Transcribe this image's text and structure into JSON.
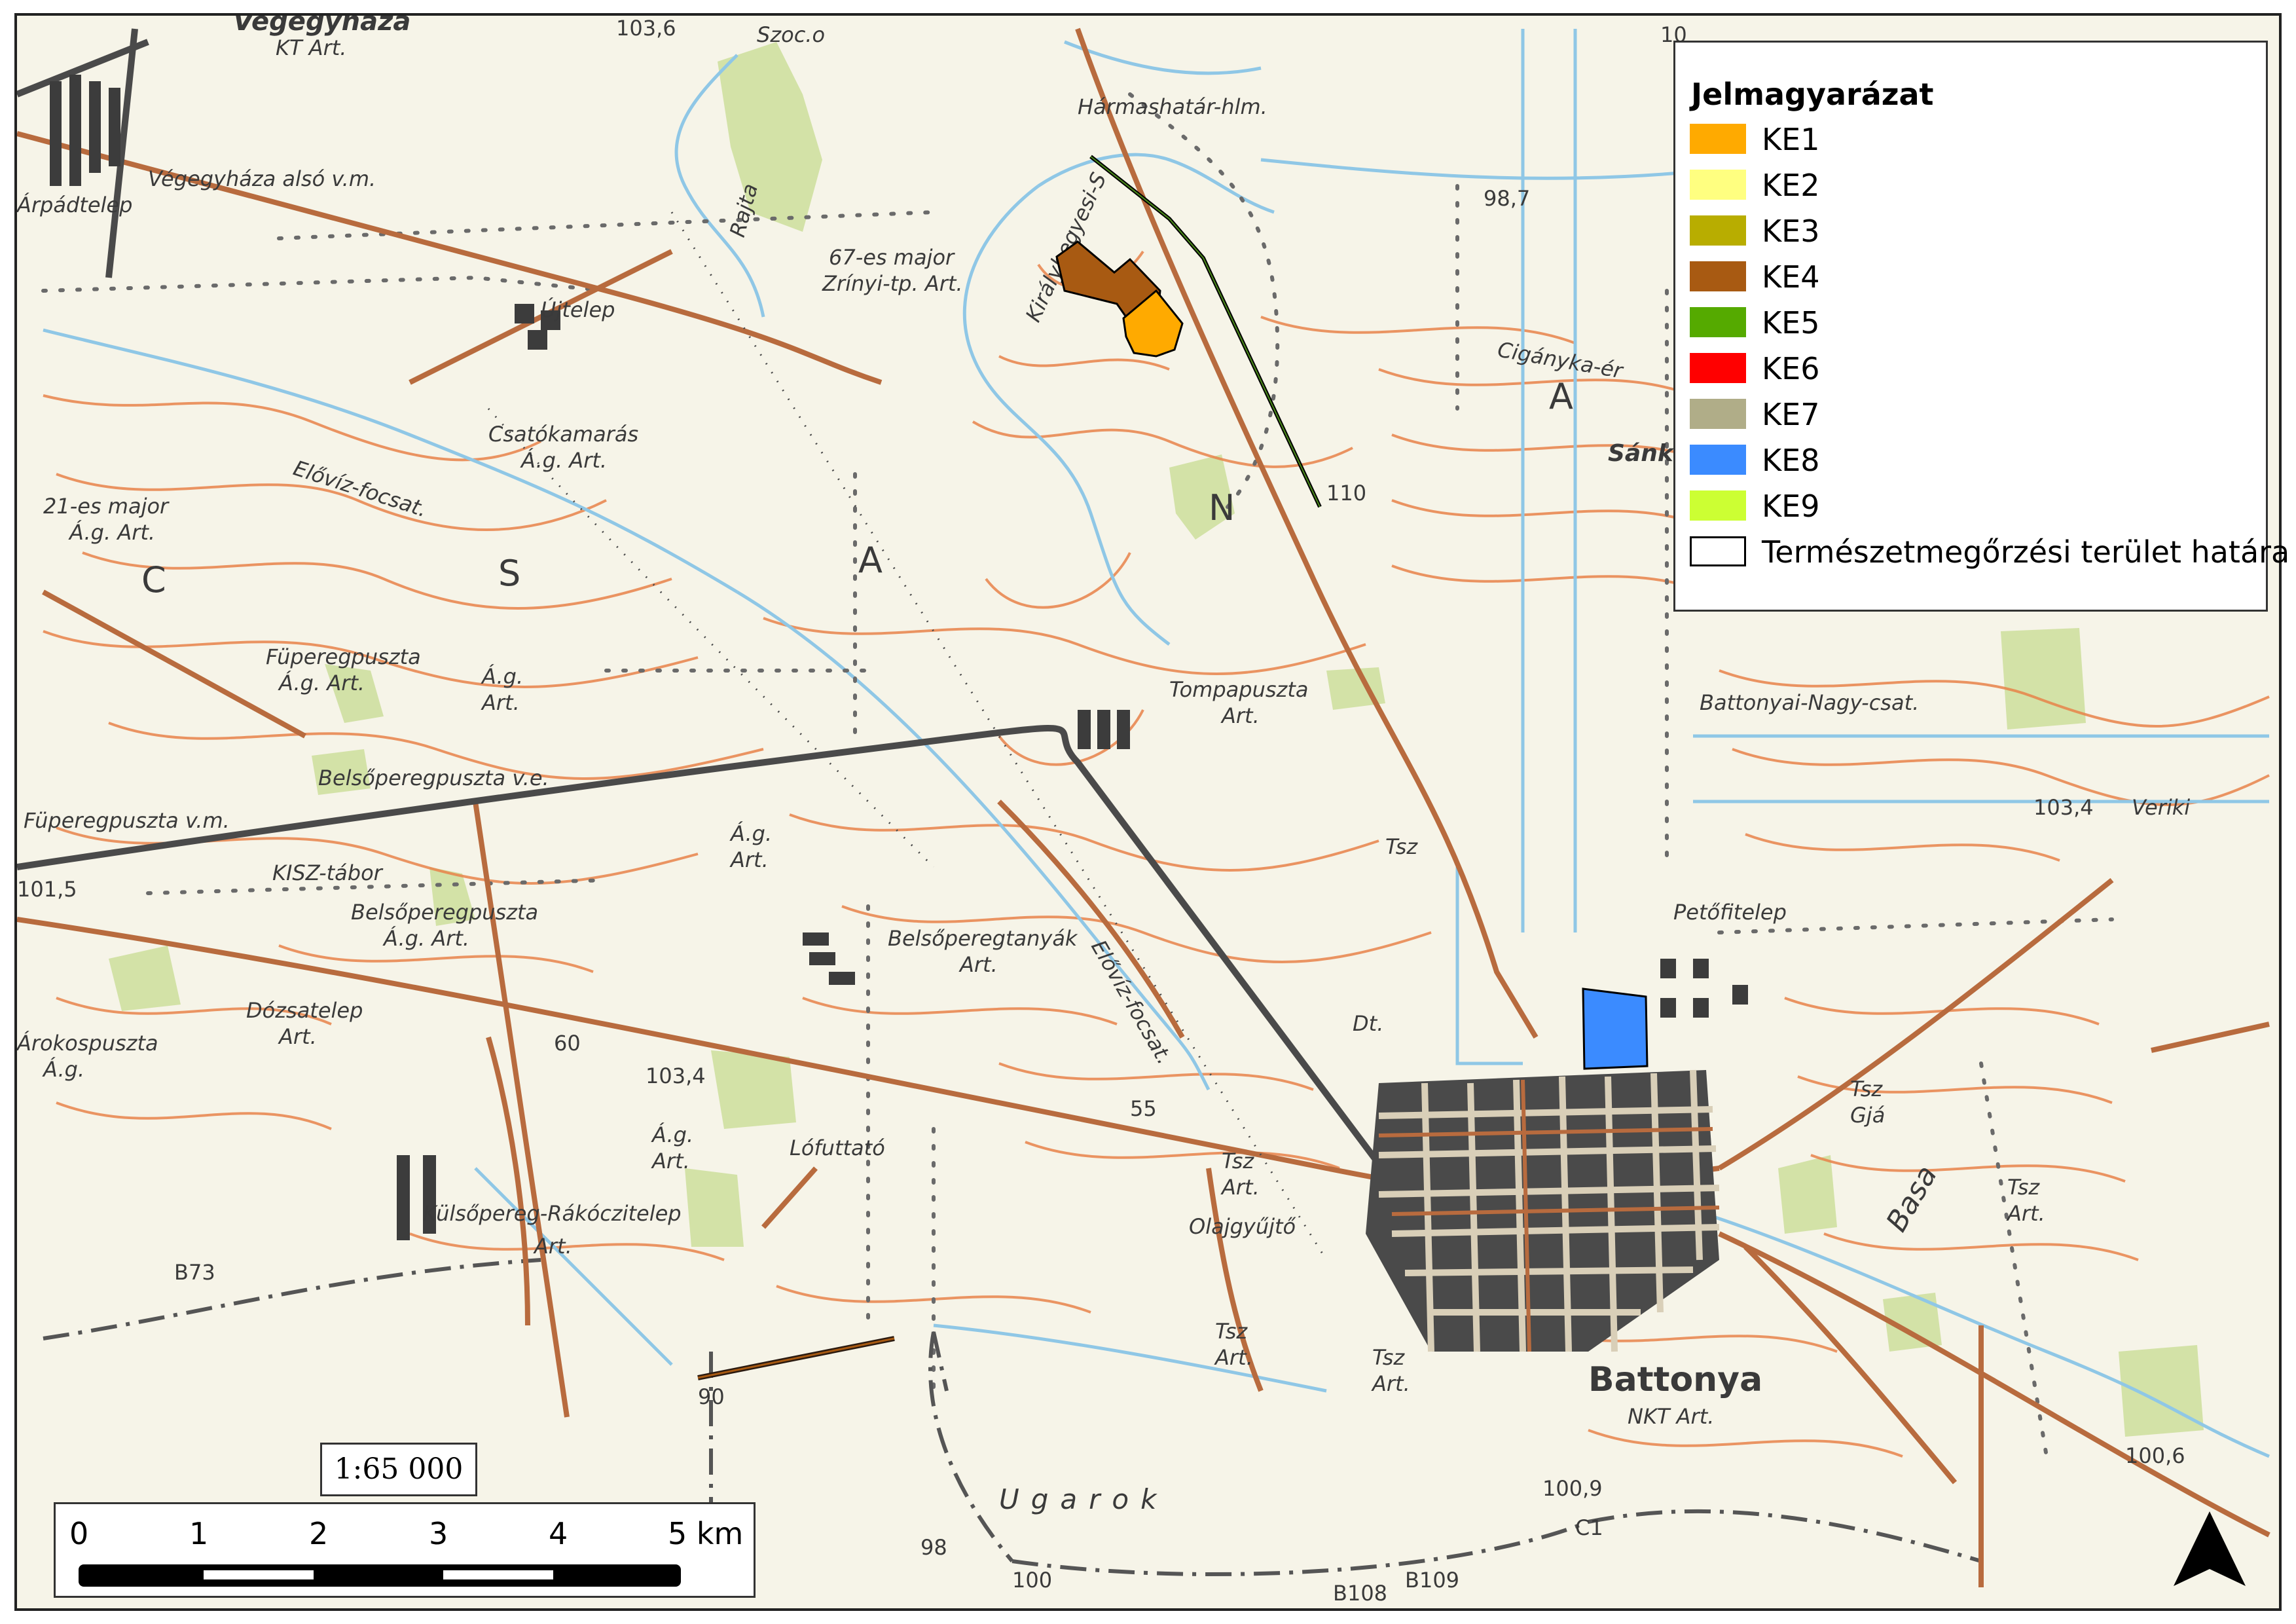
{
  "map": {
    "labels": [
      "Végegyháza",
      "KT Art.",
      "103,6",
      "Szoc.o",
      "Hármashatár-hlm.",
      "Végegyháza alsó v.m.",
      "Árpádtelep",
      "Rajta",
      "67-es major",
      "Zrínyi-tp. Art.",
      "Királyhegyesi-S",
      "Újtelep",
      "Csatókamarás",
      "Á.g. Art.",
      "Elővíz-focsat.",
      "21-es major",
      "Á.g. Art.",
      "C",
      "S",
      "A",
      "N",
      "A",
      "98,7",
      "Cigányka-ér",
      "Sánka",
      "Tompapuszta",
      "Art.",
      "Battonyai-Nagy-csat.",
      "Füperegpuszta",
      "Á.g. Art.",
      "Á.g.",
      "Art.",
      "Belsőperegpuszta v.e.",
      "Füperegpuszta v.m.",
      "101,5",
      "KISZ-tábor",
      "Belsőperegpuszta",
      "Á.g. Art.",
      "Á.g.",
      "Art.",
      "Belsőperegtanyák",
      "Art.",
      "Elővíz-focsat.",
      "Tsz",
      "Petőfitelep",
      "103,4",
      "Veriki",
      "Dózsatelep",
      "Art.",
      "Árokospuszta",
      "Á.g.",
      "60",
      "103,4",
      "Lófuttató",
      "Á.g.",
      "Art.",
      "Tsz",
      "Art.",
      "Olajgyűjtő",
      "Külsőpereg-Rákóczitelep",
      "Art.",
      "B73",
      "Tsz",
      "Art.",
      "Battonya",
      "NKT Art.",
      "Tsz",
      "Art.",
      "Tsz",
      "Art.",
      "Tsz",
      "Gjá",
      "Basa",
      "Ugarok",
      "100,9",
      "100,6",
      "90",
      "98",
      "100",
      "C1",
      "B108",
      "B109",
      "Dt.",
      "10",
      "55",
      "110"
    ],
    "protected_areas": [
      {
        "code": "KE4",
        "color": "#a85a12"
      },
      {
        "code": "KE1",
        "color": "#ffaa00"
      },
      {
        "code": "KE8",
        "color": "#3b8bff"
      }
    ]
  },
  "legend": {
    "title": "Jelmagyarázat",
    "items": [
      {
        "label": "KE1",
        "color": "#ffaa00"
      },
      {
        "label": "KE2",
        "color": "#ffff80"
      },
      {
        "label": "KE3",
        "color": "#b8ad00"
      },
      {
        "label": "KE4",
        "color": "#a85a12"
      },
      {
        "label": "KE5",
        "color": "#55aa00"
      },
      {
        "label": "KE6",
        "color": "#ff0000"
      },
      {
        "label": "KE7",
        "color": "#b0ad88"
      },
      {
        "label": "KE8",
        "color": "#3b8bff"
      },
      {
        "label": "KE9",
        "color": "#ccff33"
      },
      {
        "label": "Természetmegőrzési terület határa",
        "color": "#ffffff"
      }
    ]
  },
  "scale": {
    "ratio": "1:65 000",
    "ticks": [
      "0",
      "1",
      "2",
      "3",
      "4",
      "5 km"
    ]
  },
  "north_arrow": {
    "icon": "north-arrow-icon"
  }
}
